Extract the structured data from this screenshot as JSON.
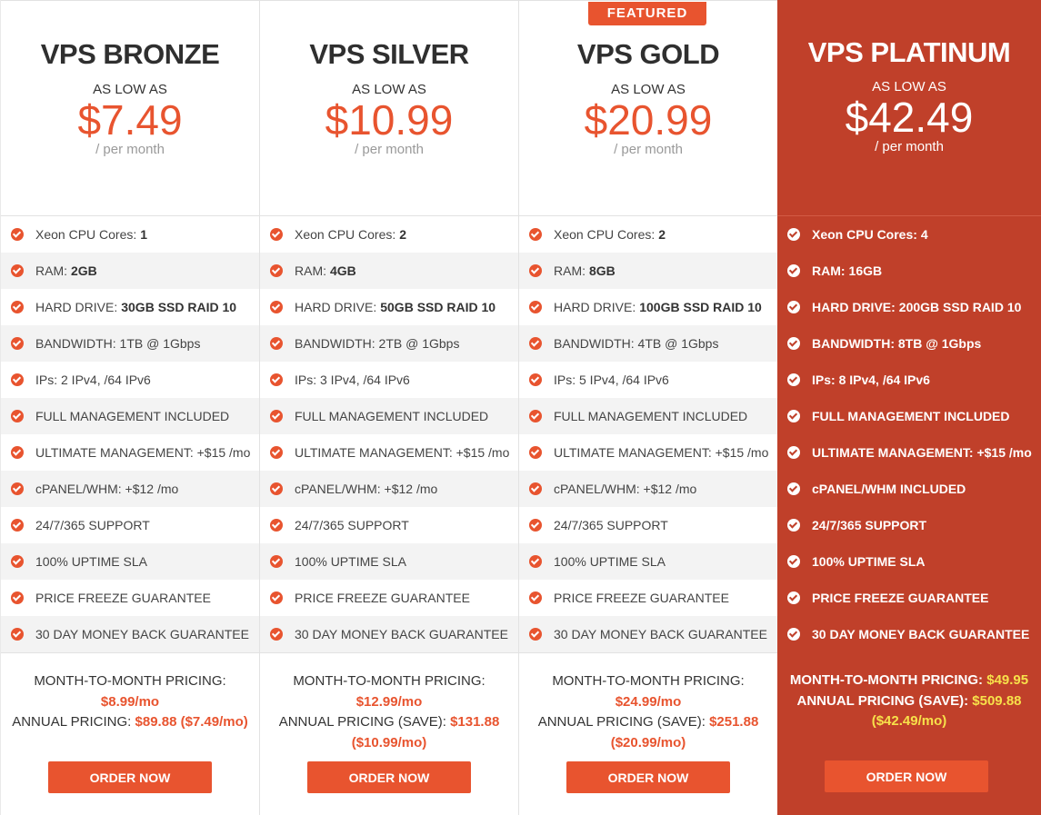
{
  "featured_label": "FEATURED",
  "as_low_label": "AS LOW AS",
  "per_label": "/ per month",
  "order_label": "ORDER NOW",
  "colors": {
    "accent": "#e8542f",
    "platinum_bg": "#c0402a",
    "platinum_highlight": "#f7e14a"
  },
  "plans": [
    {
      "name": "VPS BRONZE",
      "price": "$7.49",
      "features": [
        {
          "label": "Xeon CPU Cores:",
          "value": "1"
        },
        {
          "label": "RAM:",
          "value": "2GB"
        },
        {
          "label": "HARD DRIVE:",
          "value": "30GB SSD RAID 10"
        },
        {
          "label": "BANDWIDTH: 1TB @ 1Gbps",
          "value": ""
        },
        {
          "label": "IPs: 2 IPv4, /64 IPv6",
          "value": ""
        },
        {
          "label": "FULL MANAGEMENT INCLUDED",
          "value": ""
        },
        {
          "label": "ULTIMATE MANAGEMENT: +$15 /mo",
          "value": ""
        },
        {
          "label": "cPANEL/WHM: +$12 /mo",
          "value": ""
        },
        {
          "label": "24/7/365 SUPPORT",
          "value": ""
        },
        {
          "label": "100% UPTIME SLA",
          "value": ""
        },
        {
          "label": "PRICE FREEZE GUARANTEE",
          "value": ""
        },
        {
          "label": "30 DAY MONEY BACK GUARANTEE",
          "value": ""
        }
      ],
      "monthly_label": "MONTH-TO-MONTH PRICING:",
      "monthly_value": "$8.99/mo",
      "annual_label": "ANNUAL PRICING:",
      "annual_value": "$89.88 ($7.49/mo)"
    },
    {
      "name": "VPS SILVER",
      "price": "$10.99",
      "features": [
        {
          "label": "Xeon CPU Cores:",
          "value": "2"
        },
        {
          "label": "RAM:",
          "value": "4GB"
        },
        {
          "label": "HARD DRIVE:",
          "value": "50GB SSD RAID 10"
        },
        {
          "label": "BANDWIDTH: 2TB @ 1Gbps",
          "value": ""
        },
        {
          "label": "IPs: 3 IPv4, /64 IPv6",
          "value": ""
        },
        {
          "label": "FULL MANAGEMENT INCLUDED",
          "value": ""
        },
        {
          "label": "ULTIMATE MANAGEMENT: +$15 /mo",
          "value": ""
        },
        {
          "label": "cPANEL/WHM: +$12 /mo",
          "value": ""
        },
        {
          "label": "24/7/365 SUPPORT",
          "value": ""
        },
        {
          "label": "100% UPTIME SLA",
          "value": ""
        },
        {
          "label": "PRICE FREEZE GUARANTEE",
          "value": ""
        },
        {
          "label": "30 DAY MONEY BACK GUARANTEE",
          "value": ""
        }
      ],
      "monthly_label": "MONTH-TO-MONTH PRICING:",
      "monthly_value": "$12.99/mo",
      "annual_label": "ANNUAL PRICING (SAVE):",
      "annual_value": "$131.88",
      "annual_extra": "($10.99/mo)"
    },
    {
      "name": "VPS GOLD",
      "price": "$20.99",
      "featured": true,
      "features": [
        {
          "label": "Xeon CPU Cores:",
          "value": "2"
        },
        {
          "label": "RAM:",
          "value": "8GB"
        },
        {
          "label": "HARD DRIVE:",
          "value": "100GB SSD RAID 10"
        },
        {
          "label": "BANDWIDTH: 4TB @ 1Gbps",
          "value": ""
        },
        {
          "label": "IPs: 5 IPv4, /64 IPv6",
          "value": ""
        },
        {
          "label": "FULL MANAGEMENT INCLUDED",
          "value": ""
        },
        {
          "label": "ULTIMATE MANAGEMENT: +$15 /mo",
          "value": ""
        },
        {
          "label": "cPANEL/WHM: +$12 /mo",
          "value": ""
        },
        {
          "label": "24/7/365 SUPPORT",
          "value": ""
        },
        {
          "label": "100% UPTIME SLA",
          "value": ""
        },
        {
          "label": "PRICE FREEZE GUARANTEE",
          "value": ""
        },
        {
          "label": "30 DAY MONEY BACK GUARANTEE",
          "value": ""
        }
      ],
      "monthly_label": "MONTH-TO-MONTH PRICING:",
      "monthly_value": "$24.99/mo",
      "annual_label": "ANNUAL PRICING (SAVE):",
      "annual_value": "$251.88",
      "annual_extra": "($20.99/mo)"
    },
    {
      "name": "VPS PLATINUM",
      "price": "$42.49",
      "features": [
        {
          "label": "Xeon CPU Cores:",
          "value": "4"
        },
        {
          "label": "RAM:",
          "value": "16GB"
        },
        {
          "label": "HARD DRIVE:",
          "value": "200GB SSD RAID 10"
        },
        {
          "label": "BANDWIDTH: 8TB @ 1Gbps",
          "value": ""
        },
        {
          "label": "IPs: 8 IPv4, /64 IPv6",
          "value": ""
        },
        {
          "label": "FULL MANAGEMENT INCLUDED",
          "value": ""
        },
        {
          "label": "ULTIMATE MANAGEMENT: +$15 /mo",
          "value": ""
        },
        {
          "label": "cPANEL/WHM INCLUDED",
          "value": ""
        },
        {
          "label": "24/7/365 SUPPORT",
          "value": ""
        },
        {
          "label": "100% UPTIME SLA",
          "value": ""
        },
        {
          "label": "PRICE FREEZE GUARANTEE",
          "value": ""
        },
        {
          "label": "30 DAY MONEY BACK GUARANTEE",
          "value": ""
        }
      ],
      "monthly_label": "MONTH-TO-MONTH PRICING:",
      "monthly_value": "$49.95",
      "annual_label": "ANNUAL PRICING (SAVE):",
      "annual_value": "$509.88",
      "annual_extra": "($42.49/mo)"
    }
  ]
}
